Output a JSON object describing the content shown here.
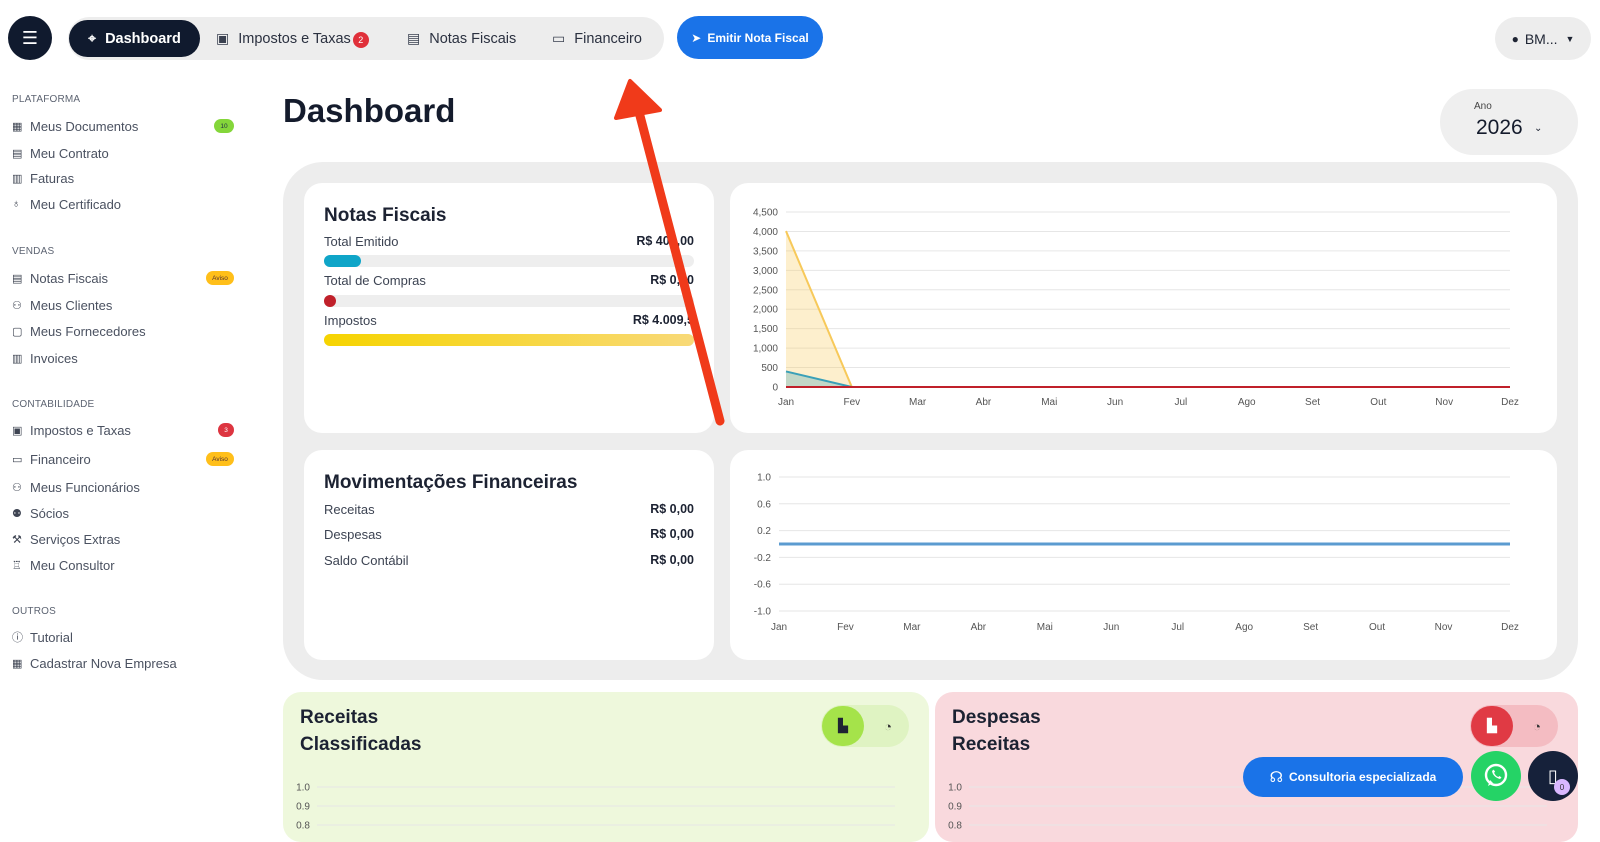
{
  "topbar": {
    "nav": [
      {
        "label": "Dashboard",
        "icon": "crosshair-icon"
      },
      {
        "label": "Impostos e Taxas",
        "icon": "wallet-icon",
        "badge": "2"
      },
      {
        "label": "Notas Fiscais",
        "icon": "receipt-icon"
      },
      {
        "label": "Financeiro",
        "icon": "money-icon"
      }
    ],
    "emit_label": "Emitir Nota Fiscal",
    "user_label": "BM..."
  },
  "sidebar": {
    "sections": [
      {
        "title": "PLATAFORMA",
        "items": [
          {
            "label": "Meus Documentos",
            "tag": "10"
          },
          {
            "label": "Meu Contrato"
          },
          {
            "label": "Faturas"
          },
          {
            "label": "Meu Certificado"
          }
        ]
      },
      {
        "title": "VENDAS",
        "items": [
          {
            "label": "Notas Fiscais",
            "tag": "Aviso"
          },
          {
            "label": "Meus Clientes"
          },
          {
            "label": "Meus Fornecedores"
          },
          {
            "label": "Invoices"
          }
        ]
      },
      {
        "title": "CONTABILIDADE",
        "items": [
          {
            "label": "Impostos e Taxas",
            "tag": "3"
          },
          {
            "label": "Financeiro",
            "tag": "Aviso"
          },
          {
            "label": "Meus Funcionários"
          },
          {
            "label": "Sócios"
          },
          {
            "label": "Serviços Extras"
          },
          {
            "label": "Meu Consultor"
          }
        ]
      },
      {
        "title": "OUTROS",
        "items": [
          {
            "label": "Tutorial"
          },
          {
            "label": "Cadastrar Nova Empresa"
          }
        ]
      }
    ]
  },
  "main": {
    "title": "Dashboard",
    "year_label": "Ano",
    "year_value": "2026",
    "notas": {
      "title": "Notas Fiscais",
      "rows": [
        {
          "label": "Total Emitido",
          "value": "R$ 400,00",
          "fill": 0.1,
          "color": "#0fa5c8"
        },
        {
          "label": "Total de Compras",
          "value": "R$ 0,00",
          "fill": 0.0,
          "color": "#c0202a"
        },
        {
          "label": "Impostos",
          "value": "R$ 4.009,5",
          "fill": 1.0,
          "color": "#f6d400"
        }
      ]
    },
    "movimentacoes": {
      "title": "Movimentações Financeiras",
      "rows": [
        {
          "label": "Receitas",
          "value": "R$ 0,00"
        },
        {
          "label": "Despesas",
          "value": "R$ 0,00"
        },
        {
          "label": "Saldo Contábil",
          "value": "R$ 0,00"
        }
      ]
    },
    "receitas_card": {
      "title": "Receitas Classificadas",
      "color": "#eef8dc",
      "accent": "#a5e34a"
    },
    "despesas_card": {
      "title": "Despesas Receitas",
      "color": "#f9d9dd",
      "accent": "#e03a44"
    }
  },
  "floating": {
    "consult_label": "Consultoria especializada",
    "doc_count": "0"
  },
  "chart_data": [
    {
      "type": "area",
      "categories": [
        "Jan",
        "Fev",
        "Mar",
        "Abr",
        "Mai",
        "Jun",
        "Jul",
        "Ago",
        "Set",
        "Out",
        "Nov",
        "Dez"
      ],
      "yticks": [
        "4,500",
        "4,000",
        "3,500",
        "3,000",
        "2,500",
        "2,000",
        "1,500",
        "1,000",
        "500",
        "0"
      ],
      "ylim": [
        0,
        4500
      ],
      "series": [
        {
          "values": [
            4009.5,
            0,
            0,
            0,
            0,
            0,
            0,
            0,
            0,
            0,
            0,
            0
          ],
          "color": "#f7c95a"
        },
        {
          "values": [
            400,
            0,
            0,
            0,
            0,
            0,
            0,
            0,
            0,
            0,
            0,
            0
          ],
          "color": "#3aa0b8"
        },
        {
          "values": [
            0,
            0,
            0,
            0,
            0,
            0,
            0,
            0,
            0,
            0,
            0,
            0
          ],
          "color": "#c0202a"
        }
      ]
    },
    {
      "type": "line",
      "categories": [
        "Jan",
        "Fev",
        "Mar",
        "Abr",
        "Mai",
        "Jun",
        "Jul",
        "Ago",
        "Set",
        "Out",
        "Nov",
        "Dez"
      ],
      "yticks": [
        "1.0",
        "0.6",
        "0.2",
        "-0.2",
        "-0.6",
        "-1.0"
      ],
      "ylim": [
        -1,
        1
      ],
      "series": [
        {
          "values": [
            0,
            0,
            0,
            0,
            0,
            0,
            0,
            0,
            0,
            0,
            0,
            0
          ],
          "color": "#5b9bd0"
        }
      ]
    },
    {
      "type": "bar",
      "yticks": [
        "1.0",
        "0.9",
        "0.8"
      ],
      "ylim": [
        0,
        1
      ]
    },
    {
      "type": "bar",
      "yticks": [
        "1.0",
        "0.9",
        "0.8"
      ],
      "ylim": [
        0,
        1
      ]
    }
  ]
}
